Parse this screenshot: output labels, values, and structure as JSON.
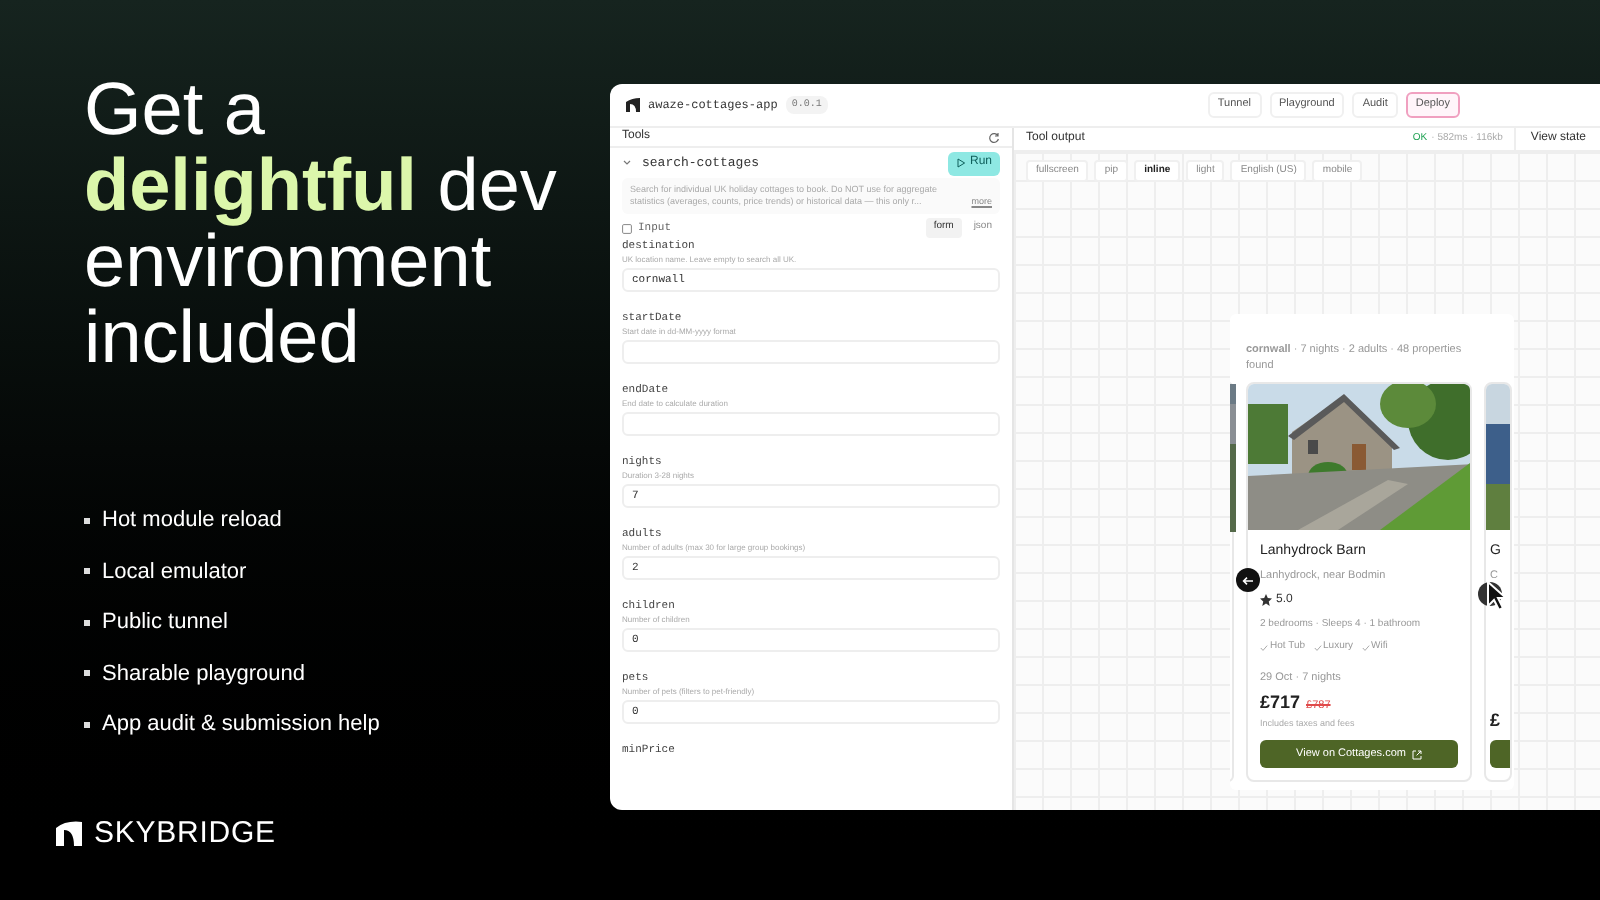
{
  "headline": "Get a **delightful** dev environment included",
  "features": [
    "Hot module reload",
    "Local emulator",
    "Public tunnel",
    "Sharable playground",
    "App audit & submission help"
  ],
  "brand": "SKYBRIDGE",
  "app": {
    "name": "awaze-cottages-app",
    "version": "0.0.1",
    "nav": [
      {
        "label": "Tunnel",
        "highlighted": false
      },
      {
        "label": "Playground",
        "highlighted": false
      },
      {
        "label": "Audit",
        "highlighted": false
      },
      {
        "label": "Deploy",
        "highlighted": true
      }
    ],
    "tools_title": "Tools",
    "tool": {
      "name": "search-cottages",
      "expanded": true,
      "run": "Run",
      "description": "Search for individual UK holiday cottages to book. Do NOT use for aggregate statistics (averages, counts, price trends) or historical data — this only r...",
      "more": "more"
    },
    "input": {
      "label": "Input",
      "modes": [
        {
          "label": "form",
          "selected": true
        },
        {
          "label": "json",
          "selected": false
        }
      ]
    },
    "fields": [
      {
        "name": "destination",
        "hint": "UK location name. Leave empty to search all UK.",
        "value": "cornwall"
      },
      {
        "name": "startDate",
        "hint": "Start date in dd-MM-yyyy format"
      },
      {
        "name": "endDate",
        "hint": "End date to calculate duration"
      },
      {
        "name": "nights",
        "hint": "Duration 3-28 nights",
        "value": "7"
      },
      {
        "name": "adults",
        "hint": "Number of adults (max 30 for large group bookings)",
        "value": "2"
      },
      {
        "name": "children",
        "hint": "Number of children",
        "value": "0"
      },
      {
        "name": "pets",
        "hint": "Number of pets (filters to pet-friendly)",
        "value": "0"
      },
      {
        "name": "minPrice"
      }
    ],
    "output": {
      "title": "Tool output",
      "status": "OK",
      "stats": "· 582ms · 116kb",
      "view_state": "View state",
      "views": [
        {
          "label": "fullscreen",
          "selected": false
        },
        {
          "label": "pip",
          "selected": false
        },
        {
          "label": "inline",
          "selected": true
        },
        {
          "label": "light",
          "selected": false
        },
        {
          "label": "English (US)",
          "selected": false
        },
        {
          "label": "mobile",
          "selected": false
        }
      ]
    },
    "widget": {
      "summary": "**cornwall** · 7 nights · 2 adults · 48 properties found",
      "card": {
        "title": "Lanhydrock Barn",
        "location": "Lanhydrock, near Bodmin",
        "rating": "5.0",
        "details": "2 bedrooms · Sleeps 4 · 1 bathroom",
        "amenities": [
          "Hot Tub",
          "Luxury",
          "Wifi"
        ],
        "dates": "29 Oct · 7 nights",
        "price": "£717",
        "old_price": "£787",
        "note": "Includes taxes and fees",
        "button": "View on Cottages.com"
      },
      "next_card": {
        "title": "G",
        "location": "C",
        "price": "£"
      }
    }
  }
}
